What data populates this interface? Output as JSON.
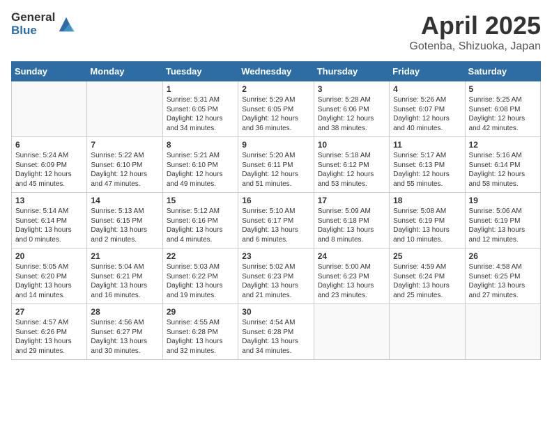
{
  "logo": {
    "general": "General",
    "blue": "Blue"
  },
  "title": "April 2025",
  "subtitle": "Gotenba, Shizuoka, Japan",
  "days_of_week": [
    "Sunday",
    "Monday",
    "Tuesday",
    "Wednesday",
    "Thursday",
    "Friday",
    "Saturday"
  ],
  "weeks": [
    [
      {
        "day": "",
        "details": ""
      },
      {
        "day": "",
        "details": ""
      },
      {
        "day": "1",
        "details": "Sunrise: 5:31 AM\nSunset: 6:05 PM\nDaylight: 12 hours and 34 minutes."
      },
      {
        "day": "2",
        "details": "Sunrise: 5:29 AM\nSunset: 6:05 PM\nDaylight: 12 hours and 36 minutes."
      },
      {
        "day": "3",
        "details": "Sunrise: 5:28 AM\nSunset: 6:06 PM\nDaylight: 12 hours and 38 minutes."
      },
      {
        "day": "4",
        "details": "Sunrise: 5:26 AM\nSunset: 6:07 PM\nDaylight: 12 hours and 40 minutes."
      },
      {
        "day": "5",
        "details": "Sunrise: 5:25 AM\nSunset: 6:08 PM\nDaylight: 12 hours and 42 minutes."
      }
    ],
    [
      {
        "day": "6",
        "details": "Sunrise: 5:24 AM\nSunset: 6:09 PM\nDaylight: 12 hours and 45 minutes."
      },
      {
        "day": "7",
        "details": "Sunrise: 5:22 AM\nSunset: 6:10 PM\nDaylight: 12 hours and 47 minutes."
      },
      {
        "day": "8",
        "details": "Sunrise: 5:21 AM\nSunset: 6:10 PM\nDaylight: 12 hours and 49 minutes."
      },
      {
        "day": "9",
        "details": "Sunrise: 5:20 AM\nSunset: 6:11 PM\nDaylight: 12 hours and 51 minutes."
      },
      {
        "day": "10",
        "details": "Sunrise: 5:18 AM\nSunset: 6:12 PM\nDaylight: 12 hours and 53 minutes."
      },
      {
        "day": "11",
        "details": "Sunrise: 5:17 AM\nSunset: 6:13 PM\nDaylight: 12 hours and 55 minutes."
      },
      {
        "day": "12",
        "details": "Sunrise: 5:16 AM\nSunset: 6:14 PM\nDaylight: 12 hours and 58 minutes."
      }
    ],
    [
      {
        "day": "13",
        "details": "Sunrise: 5:14 AM\nSunset: 6:14 PM\nDaylight: 13 hours and 0 minutes."
      },
      {
        "day": "14",
        "details": "Sunrise: 5:13 AM\nSunset: 6:15 PM\nDaylight: 13 hours and 2 minutes."
      },
      {
        "day": "15",
        "details": "Sunrise: 5:12 AM\nSunset: 6:16 PM\nDaylight: 13 hours and 4 minutes."
      },
      {
        "day": "16",
        "details": "Sunrise: 5:10 AM\nSunset: 6:17 PM\nDaylight: 13 hours and 6 minutes."
      },
      {
        "day": "17",
        "details": "Sunrise: 5:09 AM\nSunset: 6:18 PM\nDaylight: 13 hours and 8 minutes."
      },
      {
        "day": "18",
        "details": "Sunrise: 5:08 AM\nSunset: 6:19 PM\nDaylight: 13 hours and 10 minutes."
      },
      {
        "day": "19",
        "details": "Sunrise: 5:06 AM\nSunset: 6:19 PM\nDaylight: 13 hours and 12 minutes."
      }
    ],
    [
      {
        "day": "20",
        "details": "Sunrise: 5:05 AM\nSunset: 6:20 PM\nDaylight: 13 hours and 14 minutes."
      },
      {
        "day": "21",
        "details": "Sunrise: 5:04 AM\nSunset: 6:21 PM\nDaylight: 13 hours and 16 minutes."
      },
      {
        "day": "22",
        "details": "Sunrise: 5:03 AM\nSunset: 6:22 PM\nDaylight: 13 hours and 19 minutes."
      },
      {
        "day": "23",
        "details": "Sunrise: 5:02 AM\nSunset: 6:23 PM\nDaylight: 13 hours and 21 minutes."
      },
      {
        "day": "24",
        "details": "Sunrise: 5:00 AM\nSunset: 6:23 PM\nDaylight: 13 hours and 23 minutes."
      },
      {
        "day": "25",
        "details": "Sunrise: 4:59 AM\nSunset: 6:24 PM\nDaylight: 13 hours and 25 minutes."
      },
      {
        "day": "26",
        "details": "Sunrise: 4:58 AM\nSunset: 6:25 PM\nDaylight: 13 hours and 27 minutes."
      }
    ],
    [
      {
        "day": "27",
        "details": "Sunrise: 4:57 AM\nSunset: 6:26 PM\nDaylight: 13 hours and 29 minutes."
      },
      {
        "day": "28",
        "details": "Sunrise: 4:56 AM\nSunset: 6:27 PM\nDaylight: 13 hours and 30 minutes."
      },
      {
        "day": "29",
        "details": "Sunrise: 4:55 AM\nSunset: 6:28 PM\nDaylight: 13 hours and 32 minutes."
      },
      {
        "day": "30",
        "details": "Sunrise: 4:54 AM\nSunset: 6:28 PM\nDaylight: 13 hours and 34 minutes."
      },
      {
        "day": "",
        "details": ""
      },
      {
        "day": "",
        "details": ""
      },
      {
        "day": "",
        "details": ""
      }
    ]
  ]
}
